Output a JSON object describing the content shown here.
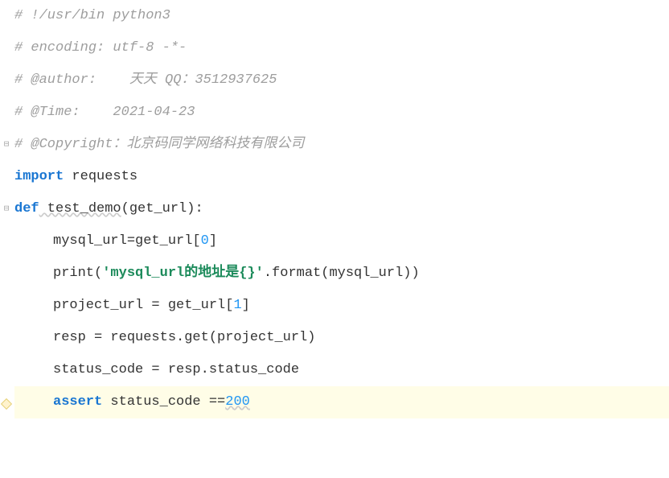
{
  "lines": {
    "l1": "# !/usr/bin python3",
    "l2": "# encoding: utf-8 -*-",
    "l3": "# @author:    天天 QQ：3512937625",
    "l4": "# @Time:    2021-04-23",
    "l5": "# @Copyright：北京码同学网络科技有限公司",
    "l6_import": "import",
    "l6_module": " requests",
    "l7_def": "def",
    "l7_name": " test_demo",
    "l7_params": "(get_url):",
    "l8": "mysql_url=get_url[",
    "l8_num": "0",
    "l8_end": "]",
    "l9_print": "print",
    "l9_open": "(",
    "l9_str": "'mysql_url的地址是{}'",
    "l9_fmt": ".format(mysql_url))",
    "l10_a": "project_url = get_url[",
    "l10_num": "1",
    "l10_end": "]",
    "l11": "resp = requests.get(project_url)",
    "l12": "status_code = resp.status_code",
    "l13_assert": "assert",
    "l13_mid": " status_code ==",
    "l13_num": "200"
  }
}
